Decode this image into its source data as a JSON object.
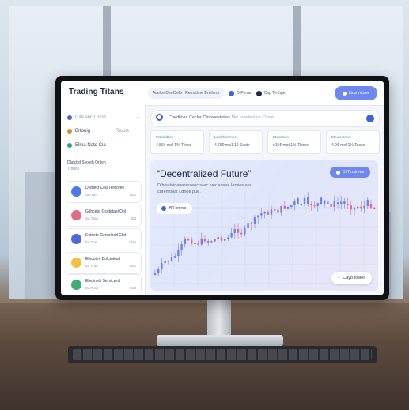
{
  "app": {
    "title": "Trading Titans"
  },
  "topnav": {
    "items": [
      {
        "label": "Acelce DeoClelo"
      },
      {
        "label": "Remsthne Dreilnrot"
      }
    ],
    "right_items": [
      {
        "label": "D Pirrae"
      },
      {
        "label": "Cap Terthpe"
      }
    ],
    "account_label": "Ltconntuore"
  },
  "sidebar": {
    "rows": [
      {
        "label": "Catl anc Orcrd",
        "muted": true
      },
      {
        "label": "Brtonig",
        "extra": "Rioule"
      },
      {
        "label": "Elma Natd Cia"
      }
    ],
    "section": {
      "title": "Dlalctrd Syoleh Ortlen",
      "sub": "Tttlnos"
    },
    "coins": [
      {
        "name": "Dretiect Cea Telicoree",
        "sub": "Saí wia",
        "value": "Uo0",
        "color": "#4a7be8"
      },
      {
        "name": "Githcelsi Ocetetasl Opl",
        "sub": "Sa Tsae",
        "value": "3d3",
        "color": "#e36b86"
      },
      {
        "name": "Eotcete Cercolocd Clot",
        "sub": "Ed Tne",
        "value": "Clse",
        "color": "#4f6bd8"
      },
      {
        "name": "Elhcoteit Dolctoteatl",
        "sub": "Ec Traa",
        "value": "Uo0",
        "color": "#f2c043"
      },
      {
        "name": "Elecinotfi Sersicwoll",
        "sub": "Ea Tuse",
        "value": "Uo0",
        "color": "#3fae72"
      }
    ]
  },
  "search": {
    "text": "Coedlioas Cecler Ctohwestoties",
    "hint": "Mei Inheleel ue Crose"
  },
  "stats": [
    {
      "title": "Prtssrilthee",
      "value": "4.56¢ mol 1% Trisos"
    },
    {
      "title": "Lacitihpirimes",
      "value": "4.780 mo1 19 Seste"
    },
    {
      "title": "Etossthes",
      "value": "r.15¢ mot 1% Tlbrue"
    },
    {
      "title": "Eteutesteam",
      "value": "4.9¢ mol 1% Toose"
    }
  ],
  "hero": {
    "title": "“Decentralized Future”",
    "subtitle": "Dtheviiatcaneiveseocra ec Iver ensee Iervies ala cdremtoiat Ldnoe pue.",
    "chip": "B0 bmrsa",
    "button": "Ci Tirrstrees",
    "cta": "Cayb Iosles"
  },
  "colors": {
    "accent": "#3d63e0",
    "accent_soft": "#6f88f0",
    "candle_up": "#6f82e6",
    "candle_down": "#e06b9a"
  },
  "icons": [
    "search-icon",
    "account-icon",
    "coin-icon",
    "chevron-down-icon"
  ]
}
